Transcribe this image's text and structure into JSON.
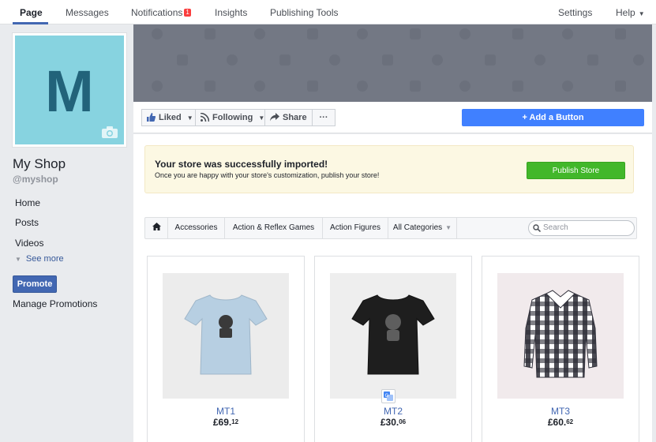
{
  "topnav": {
    "page": "Page",
    "messages": "Messages",
    "notifications": "Notifications",
    "notifications_count": "1",
    "insights": "Insights",
    "publishing_tools": "Publishing Tools",
    "settings": "Settings",
    "help": "Help"
  },
  "sidebar": {
    "avatar_letter": "M",
    "shop_name": "My Shop",
    "handle": "@myshop",
    "links": [
      "Home",
      "Posts",
      "Videos"
    ],
    "see_more": "See more",
    "promote": "Promote",
    "manage_promotions": "Manage Promotions"
  },
  "actions": {
    "liked": "Liked",
    "following": "Following",
    "share": "Share",
    "more": "···",
    "add_button": "+ Add a Button"
  },
  "notice": {
    "title": "Your store was successfully imported!",
    "text": "Once you are happy with your store's customization, publish your store!",
    "publish": "Publish Store"
  },
  "categories": {
    "items": [
      "Accessories",
      "Action & Reflex Games",
      "Action Figures"
    ],
    "all": "All Categories",
    "search_placeholder": "Search"
  },
  "products": [
    {
      "name": "MT1",
      "price_main": "£69.",
      "price_cents": "12",
      "shirt_color": "#b7cfe2"
    },
    {
      "name": "MT2",
      "price_main": "£30.",
      "price_cents": "06",
      "shirt_color": "#1e1e1e"
    },
    {
      "name": "MT3",
      "price_main": "£60.",
      "price_cents": "62",
      "shirt_color": "#f1eaec"
    }
  ],
  "colors": {
    "accent": "#4267b2",
    "cover": "#737884",
    "add_button": "#4080ff",
    "publish": "#42b72a",
    "avatar_bg": "#87d3e0",
    "avatar_letter": "#22637a"
  }
}
